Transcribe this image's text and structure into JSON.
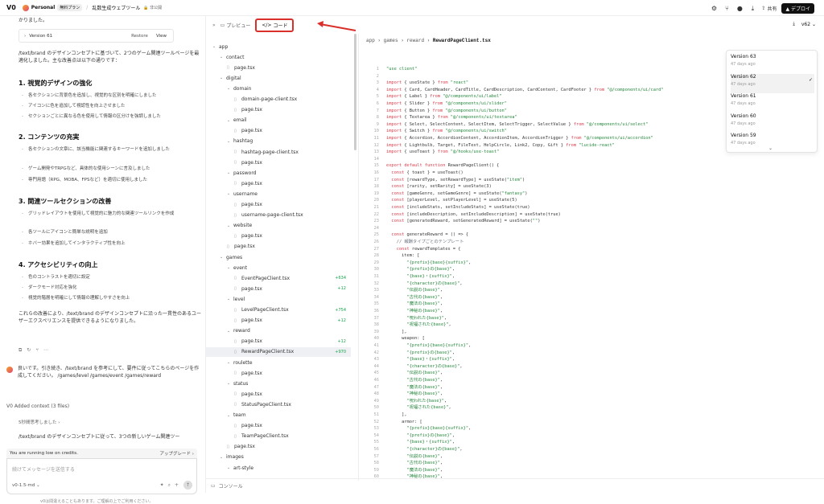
{
  "header": {
    "logo": "V0",
    "workspace": "Personal",
    "plan_badge": "無料プラン",
    "project": "乱数生成ウェブツール",
    "privacy": "非公開",
    "share": "共有",
    "deploy": "デプロイ"
  },
  "chat": {
    "top_text": "かりました。",
    "version_card": {
      "label": "Version 61",
      "restore": "Restore",
      "view": "View"
    },
    "intro": "/text/brand のデザインコンセプトに基づいて、2つのゲーム関連ツールページを最適化しました。主な改善点は以下の通りです：",
    "sections": [
      {
        "title": "1. 視覚的デザインの強化",
        "items": [
          "各セクションに背景色を追加し、視覚的な区別を明確にしました",
          "アイコンに色を追加して視認性を向上させました",
          "セクションごとに異なる色を使用して情報の区分けを強調しました"
        ]
      },
      {
        "title": "2. コンテンツの充実",
        "items": [
          "各セクションの文章に、該当機能に関連するキーワードを追加しました",
          "ゲーム開発やTRPGなど、具体的な使用シーンに言及しました",
          "専門用語（RPG、MOBA、FPSなど）を適切に使用しました"
        ]
      },
      {
        "title": "3. 関連ツールセクションの改善",
        "items": [
          "グリッドレイアウトを使用して視覚的に魅力的な関連ツールリンクを作成",
          "各ツールにアイコンと簡単な説明を追加",
          "ホバー効果を追加してインタラクティブ性を向上"
        ]
      },
      {
        "title": "4. アクセシビリティの向上",
        "items": [
          "色のコントラストを適切に設定",
          "ダークモード対応を強化",
          "視覚的階層を明確にして情報の理解しやすさを向上"
        ]
      }
    ],
    "outro": "これらの改善により、/text/brand のデザインコンセプトに沿った一貫性のあるユーザーエクスペリエンスを提供できるようになりました。",
    "user_message": "良いです。引き続き、/text/brand を参考にして、要件に従ってこちらのページを作成してください。 /games/level /games/event /games/reward",
    "added_context": "Added context (3 files)",
    "thinking": "5秒間思考しました",
    "preview_text": "/text/brand のデザインコンセプトに従って、3つの新しいゲーム関連ツー",
    "low_credits": "You are running low on credits.",
    "upgrade": "アップグレード",
    "composer_placeholder": "続けてメッセージを送信する",
    "model": "v0-1.5-md",
    "disclaimer": "v0は間違えることもあります。ご理解の上でご利用ください。"
  },
  "editor": {
    "tab_preview": "プレビュー",
    "tab_code": "コード",
    "breadcrumb": [
      "app",
      "games",
      "reward",
      "RewardPageClient.tsx"
    ],
    "version_select": "v62",
    "console": "コンソール"
  },
  "tree": [
    {
      "depth": 0,
      "type": "folder",
      "name": "app"
    },
    {
      "depth": 1,
      "type": "folder",
      "name": "contact"
    },
    {
      "depth": 2,
      "type": "file",
      "name": "page.tsx"
    },
    {
      "depth": 1,
      "type": "folder",
      "name": "digital"
    },
    {
      "depth": 2,
      "type": "folder",
      "name": "domain"
    },
    {
      "depth": 3,
      "type": "file",
      "name": "domain-page-client.tsx"
    },
    {
      "depth": 3,
      "type": "file",
      "name": "page.tsx"
    },
    {
      "depth": 2,
      "type": "folder",
      "name": "email"
    },
    {
      "depth": 3,
      "type": "file",
      "name": "page.tsx"
    },
    {
      "depth": 2,
      "type": "folder",
      "name": "hashtag"
    },
    {
      "depth": 3,
      "type": "file",
      "name": "hashtag-page-client.tsx"
    },
    {
      "depth": 3,
      "type": "file",
      "name": "page.tsx"
    },
    {
      "depth": 2,
      "type": "folder",
      "name": "password"
    },
    {
      "depth": 3,
      "type": "file",
      "name": "page.tsx"
    },
    {
      "depth": 2,
      "type": "folder",
      "name": "username"
    },
    {
      "depth": 3,
      "type": "file",
      "name": "page.tsx"
    },
    {
      "depth": 3,
      "type": "file",
      "name": "username-page-client.tsx"
    },
    {
      "depth": 2,
      "type": "folder",
      "name": "website"
    },
    {
      "depth": 3,
      "type": "file",
      "name": "page.tsx"
    },
    {
      "depth": 2,
      "type": "file",
      "name": "page.tsx"
    },
    {
      "depth": 1,
      "type": "folder",
      "name": "games"
    },
    {
      "depth": 2,
      "type": "folder",
      "name": "event"
    },
    {
      "depth": 3,
      "type": "file",
      "name": "EventPageClient.tsx",
      "count": "+634"
    },
    {
      "depth": 3,
      "type": "file",
      "name": "page.tsx",
      "count": "+12"
    },
    {
      "depth": 2,
      "type": "folder",
      "name": "level"
    },
    {
      "depth": 3,
      "type": "file",
      "name": "LevelPageClient.tsx",
      "count": "+754"
    },
    {
      "depth": 3,
      "type": "file",
      "name": "page.tsx",
      "count": "+12"
    },
    {
      "depth": 2,
      "type": "folder",
      "name": "reward"
    },
    {
      "depth": 3,
      "type": "file",
      "name": "page.tsx",
      "count": "+12"
    },
    {
      "depth": 3,
      "type": "file",
      "name": "RewardPageClient.tsx",
      "count": "+970",
      "selected": true
    },
    {
      "depth": 2,
      "type": "folder",
      "name": "roulette"
    },
    {
      "depth": 3,
      "type": "file",
      "name": "page.tsx"
    },
    {
      "depth": 2,
      "type": "folder",
      "name": "status"
    },
    {
      "depth": 3,
      "type": "file",
      "name": "page.tsx"
    },
    {
      "depth": 3,
      "type": "file",
      "name": "StatusPageClient.tsx"
    },
    {
      "depth": 2,
      "type": "folder",
      "name": "team"
    },
    {
      "depth": 3,
      "type": "file",
      "name": "page.tsx"
    },
    {
      "depth": 3,
      "type": "file",
      "name": "TeamPageClient.tsx"
    },
    {
      "depth": 2,
      "type": "file",
      "name": "page.tsx"
    },
    {
      "depth": 1,
      "type": "folder",
      "name": "images"
    },
    {
      "depth": 2,
      "type": "folder",
      "name": "art-style"
    }
  ],
  "versions": [
    {
      "name": "Version 63",
      "date": "47 days ago"
    },
    {
      "name": "Version 62",
      "date": "47 days ago",
      "active": true
    },
    {
      "name": "Version 61",
      "date": "47 days ago"
    },
    {
      "name": "Version 60",
      "date": "47 days ago"
    },
    {
      "name": "Version 59",
      "date": "47 days ago"
    }
  ],
  "code_lines": [
    "\"use client\"",
    "",
    "import { useState } from \"react\"",
    "import { Card, CardHeader, CardTitle, CardDescription, CardContent, CardFooter } from \"@/components/ui/card\"",
    "import { Label } from \"@/components/ui/label\"",
    "import { Slider } from \"@/components/ui/slider\"",
    "import { Button } from \"@/components/ui/button\"",
    "import { Textarea } from \"@/components/ui/textarea\"",
    "import { Select, SelectContent, SelectItem, SelectTrigger, SelectValue } from \"@/components/ui/select\"",
    "import { Switch } from \"@/components/ui/switch\"",
    "import { Accordion, AccordionContent, AccordionItem, AccordionTrigger } from \"@/components/ui/accordion\"",
    "import { Lightbulb, Target, FileText, HelpCircle, Link2, Copy, Gift } from \"lucide-react\"",
    "import { useToast } from \"@/hooks/use-toast\"",
    "",
    "export default function RewardPageClient() {",
    "  const { toast } = useToast()",
    "  const [rewardType, setRewardType] = useState(\"item\")",
    "  const [rarity, setRarity] = useState(3)",
    "  const [gameGenre, setGameGenre] = useState(\"fantasy\")",
    "  const [playerLevel, setPlayerLevel] = useState(5)",
    "  const [includeStats, setIncludeStats] = useState(true)",
    "  const [includeDescription, setIncludeDescription] = useState(true)",
    "  const [generatedReward, setGeneratedReward] = useState(\"\")",
    "",
    "  const generateReward = () => {",
    "    // 報酬タイプごとのテンプレート",
    "    const rewardTemplates = {",
    "      item: [",
    "        \"{prefix}{base}{suffix}\",",
    "        \"{prefix}の{base}\",",
    "        \"{base}・{suffix}\",",
    "        \"{character}の{base}\",",
    "        \"伝説の{base}\",",
    "        \"古代の{base}\",",
    "        \"魔法の{base}\",",
    "        \"神秘の{base}\",",
    "        \"呪われた{base}\",",
    "        \"祝福された{base}\",",
    "      ],",
    "      weapon: [",
    "        \"{prefix}{base}{suffix}\",",
    "        \"{prefix}の{base}\",",
    "        \"{base}・{suffix}\",",
    "        \"{character}の{base}\",",
    "        \"伝説の{base}\",",
    "        \"古代の{base}\",",
    "        \"魔法の{base}\",",
    "        \"神秘の{base}\",",
    "        \"呪われた{base}\",",
    "        \"祝福された{base}\",",
    "      ],",
    "      armor: [",
    "        \"{prefix}{base}{suffix}\",",
    "        \"{prefix}の{base}\",",
    "        \"{base}・{suffix}\",",
    "        \"{character}の{base}\",",
    "        \"伝説の{base}\",",
    "        \"古代の{base}\",",
    "        \"魔法の{base}\",",
    "        \"神秘の{base}\",",
    "        \"呪われた{base}\",",
    "        \"祝福された{base}\","
  ]
}
